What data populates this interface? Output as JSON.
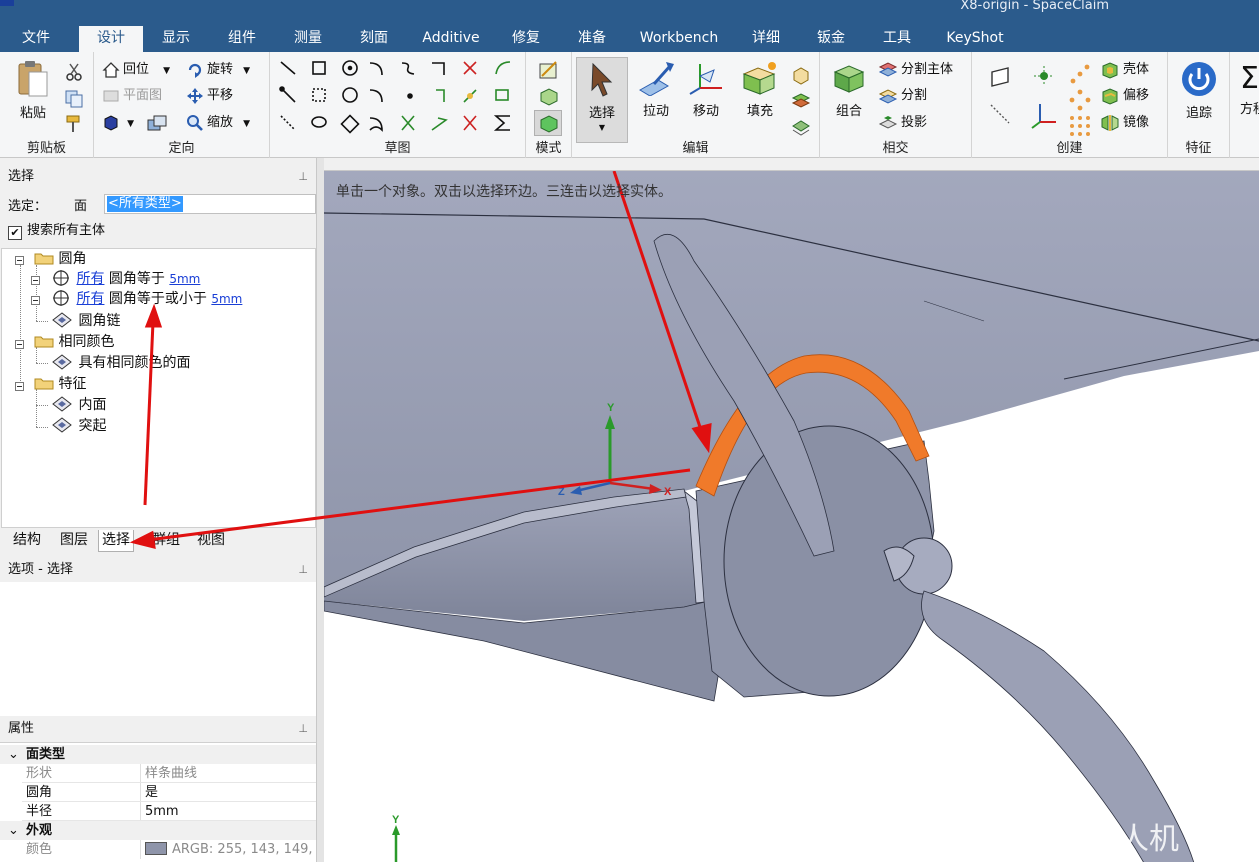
{
  "window": {
    "title": "X8-origin - SpaceClaim"
  },
  "ribbon_tabs": [
    {
      "label": "文件"
    },
    {
      "label": "设计"
    },
    {
      "label": "显示"
    },
    {
      "label": "组件"
    },
    {
      "label": "测量"
    },
    {
      "label": "刻面"
    },
    {
      "label": "Additive"
    },
    {
      "label": "修复"
    },
    {
      "label": "准备"
    },
    {
      "label": "Workbench"
    },
    {
      "label": "详细"
    },
    {
      "label": "钣金"
    },
    {
      "label": "工具"
    },
    {
      "label": "KeyShot"
    }
  ],
  "ribbon": {
    "clipboard": {
      "label": "剪贴板",
      "paste": "粘贴"
    },
    "orient": {
      "label": "定向",
      "home": "回位",
      "plane_view": "平面图",
      "spin": "旋转",
      "pan": "平移",
      "zoom": "缩放"
    },
    "sketch": {
      "label": "草图"
    },
    "mode": {
      "label": "模式"
    },
    "edit": {
      "label": "编辑",
      "select": "选择",
      "pull": "拉动",
      "move": "移动",
      "fill": "填充"
    },
    "intersect": {
      "label": "相交",
      "combine": "组合",
      "split_body": "分割主体",
      "split": "分割",
      "project": "投影"
    },
    "create": {
      "label": "创建",
      "shell": "壳体",
      "offset": "偏移",
      "mirror": "镜像"
    },
    "feature": {
      "label": "特征",
      "track": "追踪",
      "equation": "方程"
    }
  },
  "selection_panel": {
    "header": "选择",
    "selected_label": "选定：",
    "face_label": "面",
    "type_value": "<所有类型>",
    "search_all_label": "搜索所有主体",
    "search_all_checked": true,
    "tree": {
      "fillet_group": "圆角",
      "all1": "所有",
      "fillet_eq": "圆角等于",
      "fillet_eq_val": "5mm",
      "all2": "所有",
      "fillet_le": "圆角等于或小于",
      "fillet_le_val": "5mm",
      "fillet_chain": "圆角链",
      "same_color_group": "相同颜色",
      "same_color_faces": "具有相同颜色的面",
      "feature_group": "特征",
      "inner_face": "内面",
      "protrusion": "突起"
    }
  },
  "panel_tabs": [
    {
      "label": "结构"
    },
    {
      "label": "图层"
    },
    {
      "label": "选择"
    },
    {
      "label": "群组"
    },
    {
      "label": "视图"
    }
  ],
  "options_panel": {
    "header": "选项 - 选择"
  },
  "properties": {
    "header": "属性",
    "face_type_cat": "面类型",
    "shape_k": "形状",
    "shape_v": "样条曲线",
    "fillet_k": "圆角",
    "fillet_v": "是",
    "radius_k": "半径",
    "radius_v": "5mm",
    "appearance_cat": "外观",
    "color_k": "颜色",
    "color_v": "ARGB: 255, 143, 149,",
    "color_hex": "#8f95aa"
  },
  "viewport": {
    "hint": "单击一个对象。双击以选择环边。三连击以选择实体。",
    "axis_x": "X",
    "axis_y": "Y",
    "axis_z": "Z",
    "watermark": "无人机",
    "body_color": "#8f95aa",
    "highlight_color": "#f07a2a",
    "arrow_color": "#e01010"
  }
}
